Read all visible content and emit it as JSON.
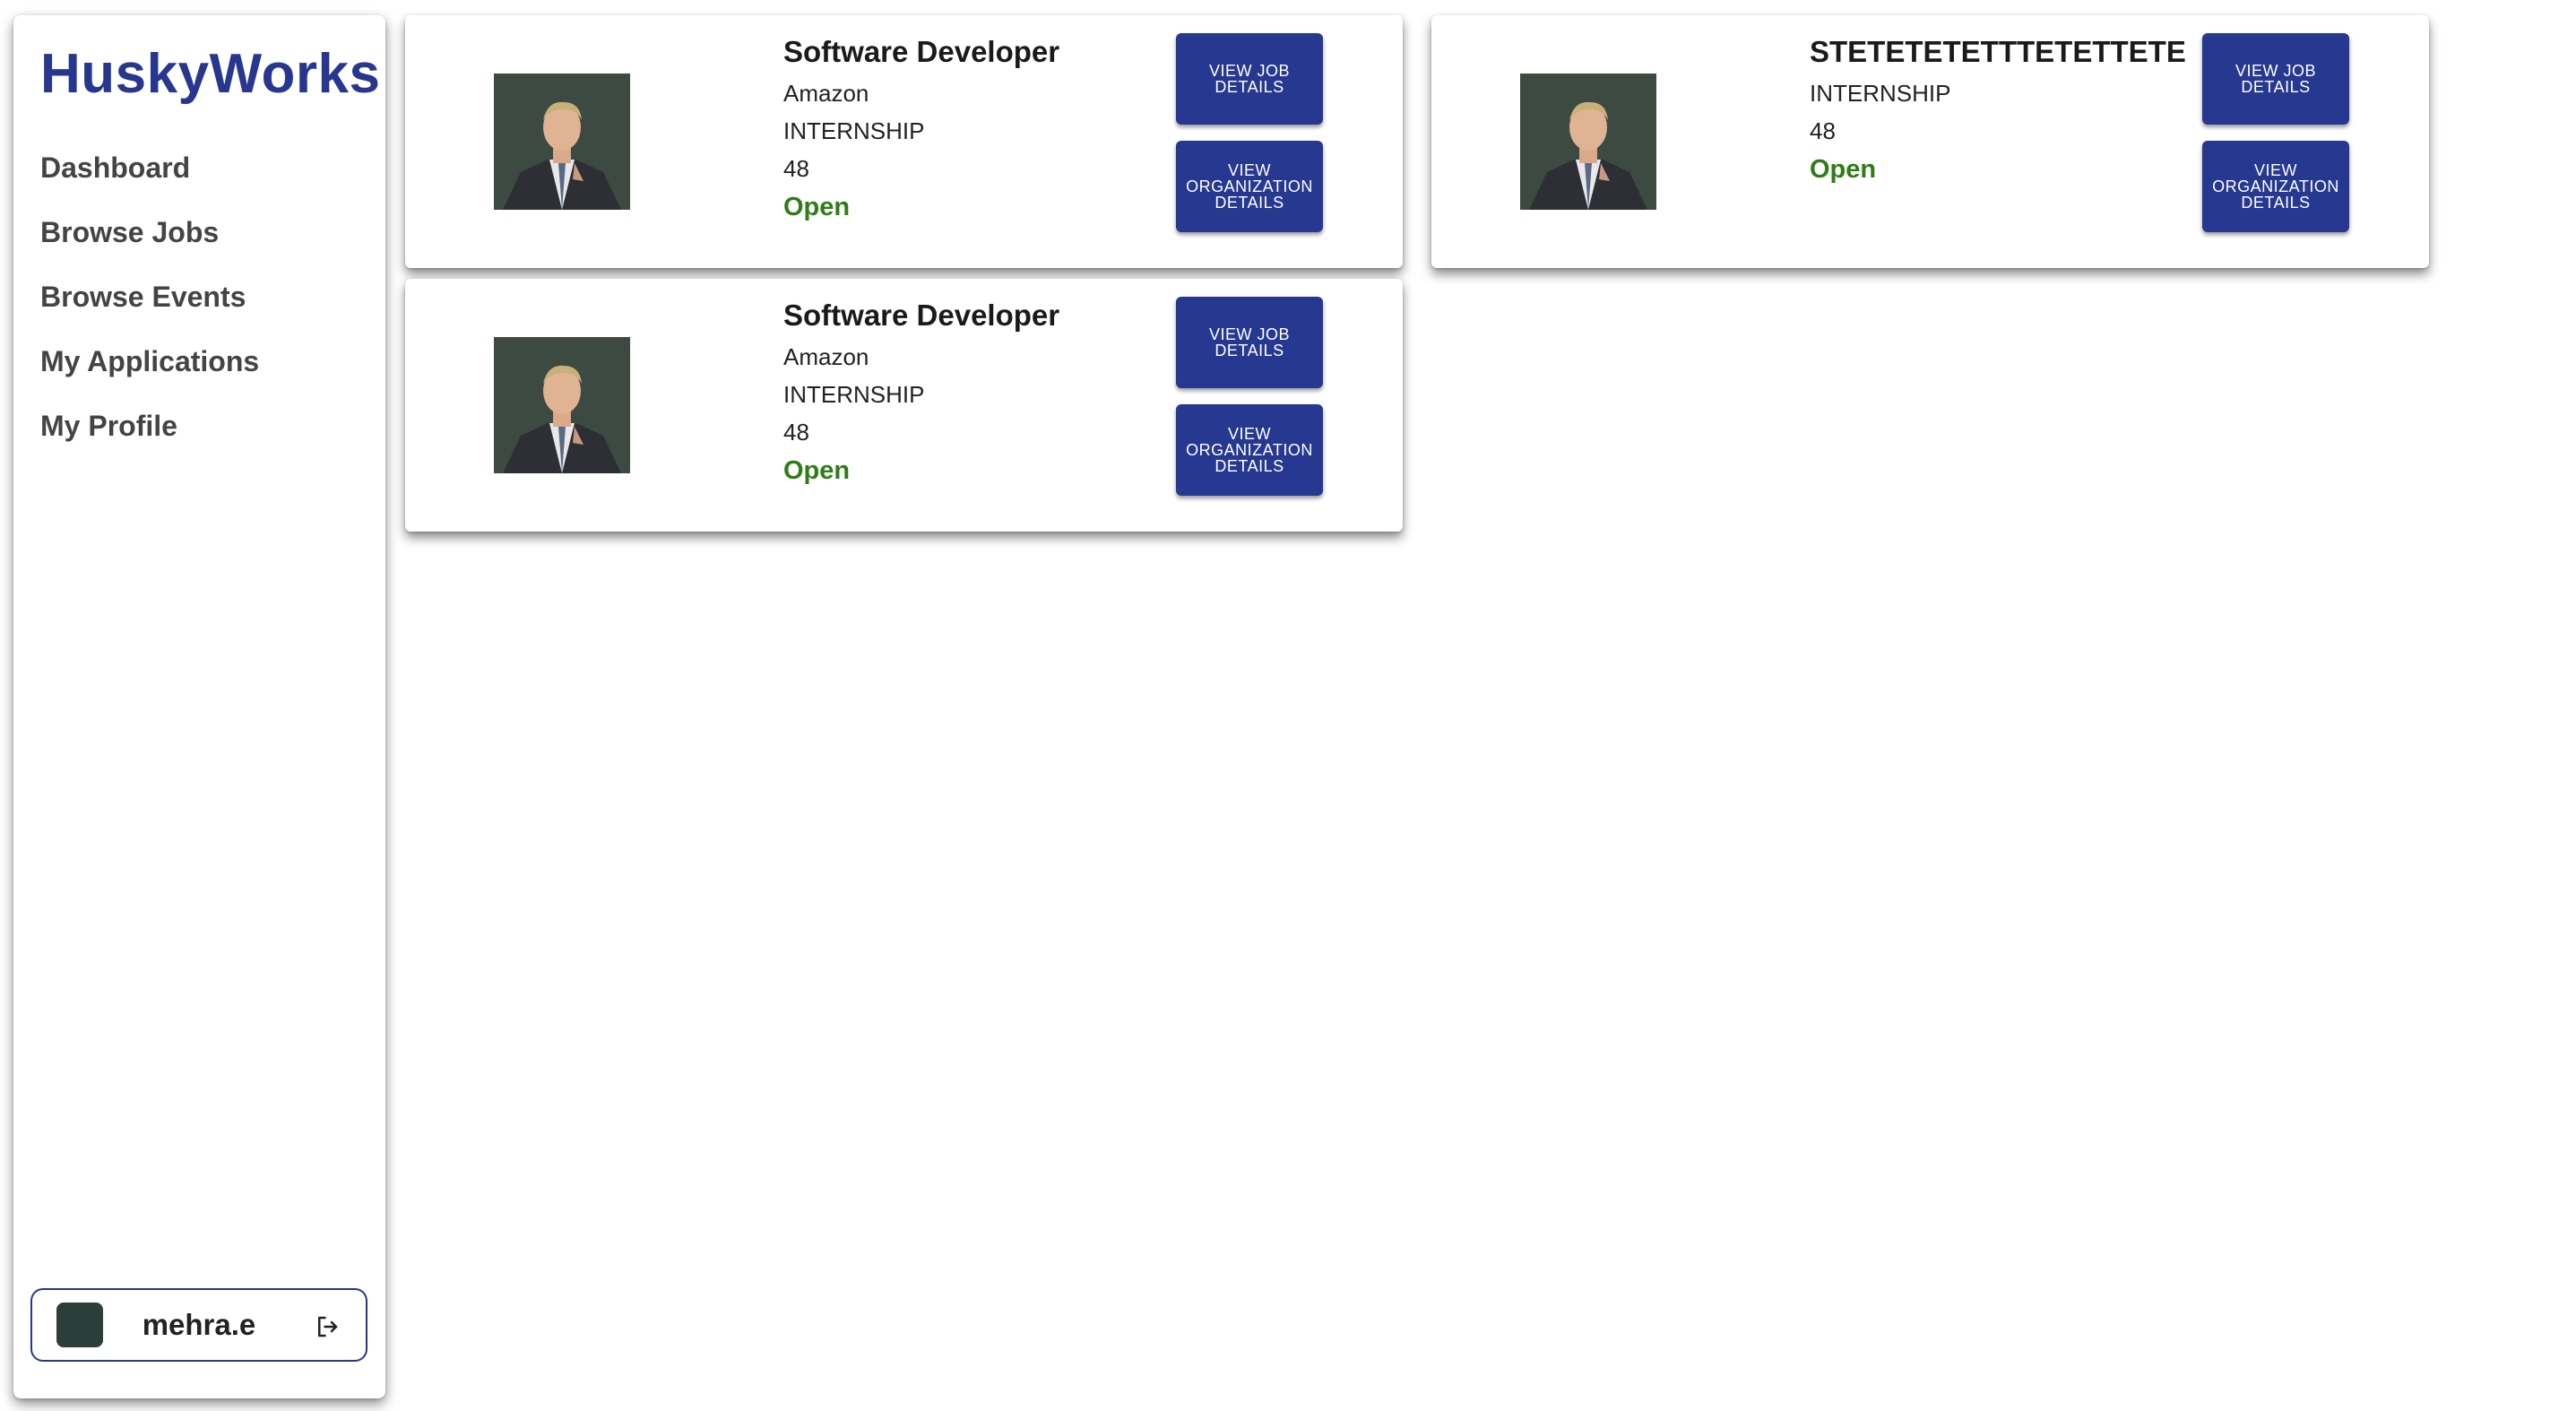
{
  "brand": "HuskyWorks",
  "nav": [
    {
      "label": "Dashboard"
    },
    {
      "label": "Browse Jobs"
    },
    {
      "label": "Browse Events"
    },
    {
      "label": "My Applications"
    },
    {
      "label": "My Profile"
    }
  ],
  "user": {
    "name": "mehra.e",
    "avatar_color": "#2c3e39"
  },
  "colors": {
    "accent": "#27378f",
    "status_open": "#2e7d16"
  },
  "icons": {
    "logout": "logout-icon",
    "photo": "profile-photo"
  },
  "jobs": [
    {
      "title": "Software Developer",
      "organization": "Amazon",
      "type": "INTERNSHIP",
      "count": "48",
      "status": "Open",
      "view_job_label": "View Job Details",
      "view_org_label": "View Organization Details"
    },
    {
      "title": "STETETETETTTETETTETE",
      "type": "INTERNSHIP",
      "count": "48",
      "status": "Open",
      "view_job_label": "View Job Details",
      "view_org_label": "View Organization Details"
    },
    {
      "title": "Software Developer",
      "organization": "Amazon",
      "type": "INTERNSHIP",
      "count": "48",
      "status": "Open",
      "view_job_label": "View Job Details",
      "view_org_label": "View Organization Details"
    }
  ]
}
